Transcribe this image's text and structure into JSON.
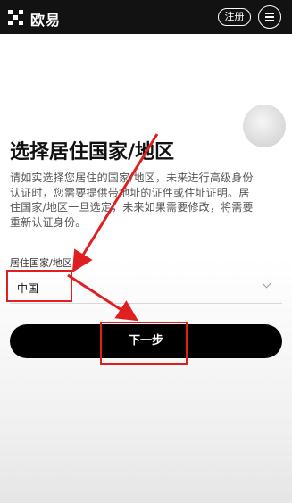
{
  "header": {
    "logo_text": "欧易",
    "register_label": "注册"
  },
  "main": {
    "title": "选择居住国家/地区",
    "description_lines": [
      "请如实选择您居住的国家/地区，未来进行高级身份",
      "认证时，您需要提供带地址的证件或住址证明。居",
      "住国家/地区一旦选定，未来如果需要修改，将需要",
      "重新认证身份。"
    ],
    "field_label": "居住国家/地区",
    "selected_value": "中国",
    "next_label": "下一步"
  },
  "colors": {
    "topbar": "#121212",
    "primary_button": "#000000",
    "annotation": "#e02020"
  },
  "icons": [
    "logo-icon",
    "menu-icon",
    "chevron-down-icon"
  ]
}
